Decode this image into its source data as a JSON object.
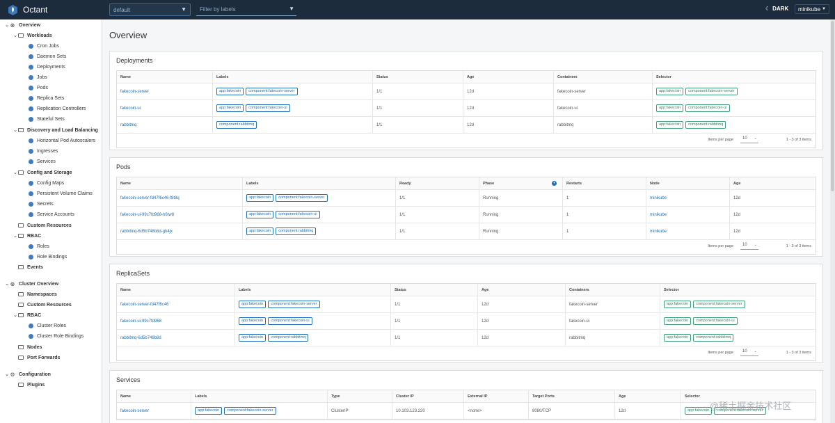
{
  "topbar": {
    "app_name": "Octant",
    "namespace": "default",
    "label_filter_placeholder": "Filter by labels",
    "theme_toggle": "DARK",
    "context": "minikube"
  },
  "sidebar": {
    "overview": "Overview",
    "workloads": "Workloads",
    "cron_jobs": "Cron Jobs",
    "daemon_sets": "Daemon Sets",
    "deployments": "Deployments",
    "jobs": "Jobs",
    "pods": "Pods",
    "replica_sets": "Replica Sets",
    "replication_controllers": "Replication Controllers",
    "stateful_sets": "Stateful Sets",
    "discovery": "Discovery and Load Balancing",
    "hpa": "Horizontal Pod Autoscalers",
    "ingresses": "Ingresses",
    "services": "Services",
    "config_storage": "Config and Storage",
    "config_maps": "Config Maps",
    "pvc": "Persistent Volume Claims",
    "secrets": "Secrets",
    "service_accounts": "Service Accounts",
    "custom_resources": "Custom Resources",
    "rbac": "RBAC",
    "roles": "Roles",
    "role_bindings": "Role Bindings",
    "events": "Events",
    "cluster_overview": "Cluster Overview",
    "namespaces": "Namespaces",
    "cluster_custom_resources": "Custom Resources",
    "cluster_rbac": "RBAC",
    "cluster_roles": "Cluster Roles",
    "cluster_role_bindings": "Cluster Role Bindings",
    "nodes": "Nodes",
    "port_forwards": "Port Forwards",
    "configuration": "Configuration",
    "plugins": "Plugins"
  },
  "page_title": "Overview",
  "pager": {
    "items_per_page": "Items per page",
    "per_page": "10",
    "range": "1 - 3 of 3 items"
  },
  "deployments": {
    "title": "Deployments",
    "headers": [
      "Name",
      "Labels",
      "Status",
      "Age",
      "Containers",
      "Selector"
    ],
    "rows": [
      {
        "name": "fakecoin-server",
        "labels": [
          "app:fakecoin",
          "component:fakecoin-server"
        ],
        "status": "1/1",
        "age": "12d",
        "containers": "fakecoin-server",
        "selector": [
          "app:fakecoin",
          "component:fakecoin-server"
        ]
      },
      {
        "name": "fakecoin-ui",
        "labels": [
          "app:fakecoin",
          "component:fakecoin-ui"
        ],
        "status": "1/1",
        "age": "12d",
        "containers": "fakecoin-ui",
        "selector": [
          "app:fakecoin",
          "component:fakecoin-ui"
        ]
      },
      {
        "name": "rabbitmq",
        "labels": [
          "component:rabbitmq"
        ],
        "status": "1/1",
        "age": "12d",
        "containers": "rabbitmq",
        "selector": [
          "app:fakecoin",
          "component:rabbitmq"
        ]
      }
    ]
  },
  "pods": {
    "title": "Pods",
    "headers": [
      "Name",
      "Labels",
      "Ready",
      "Phase",
      "Restarts",
      "Node",
      "Age"
    ],
    "rows": [
      {
        "name": "fakecoin-server-fd47f6c46-f8t8q",
        "labels": [
          "app:fakecoin",
          "component:fakecoin-server"
        ],
        "ready": "1/1",
        "phase": "Running",
        "restarts": "1",
        "node": "minikube",
        "age": "12d"
      },
      {
        "name": "fakecoin-ui-99c7fd968-h6tw8",
        "labels": [
          "app:fakecoin",
          "component:fakecoin-ui"
        ],
        "ready": "1/1",
        "phase": "Running",
        "restarts": "1",
        "node": "minikube",
        "age": "12d"
      },
      {
        "name": "rabbitmq-6d5b748b8d-gh4jx",
        "labels": [
          "app:fakecoin",
          "component:rabbitmq"
        ],
        "ready": "1/1",
        "phase": "Running",
        "restarts": "1",
        "node": "minikube",
        "age": "12d"
      }
    ]
  },
  "replicasets": {
    "title": "ReplicaSets",
    "headers": [
      "Name",
      "Labels",
      "Status",
      "Age",
      "Containers",
      "Selector"
    ],
    "rows": [
      {
        "name": "fakecoin-server-fd47f6c46",
        "labels": [
          "app:fakecoin",
          "component:fakecoin-server"
        ],
        "status": "1/1",
        "age": "12d",
        "containers": "fakecoin-server",
        "selector": [
          "app:fakecoin",
          "component:fakecoin-server"
        ]
      },
      {
        "name": "fakecoin-ui-99c7fd968",
        "labels": [
          "app:fakecoin",
          "component:fakecoin-ui"
        ],
        "status": "1/1",
        "age": "12d",
        "containers": "fakecoin-ui",
        "selector": [
          "app:fakecoin",
          "component:fakecoin-ui"
        ]
      },
      {
        "name": "rabbitmq-6d5b748b8d",
        "labels": [
          "app:fakecoin",
          "component:rabbitmq"
        ],
        "status": "1/1",
        "age": "12d",
        "containers": "rabbitmq",
        "selector": [
          "app:fakecoin",
          "component:rabbitmq"
        ]
      }
    ]
  },
  "services": {
    "title": "Services",
    "headers": [
      "Name",
      "Labels",
      "Type",
      "Cluster IP",
      "External IP",
      "Target Ports",
      "Age",
      "Selector"
    ],
    "rows": [
      {
        "name": "fakecoin-server",
        "labels": [
          "app:fakecoin",
          "component:fakecoin-server"
        ],
        "type": "ClusterIP",
        "cluster_ip": "10.103.123.220",
        "external_ip": "<none>",
        "target_ports": "8080/TCP",
        "age": "12d",
        "selector": [
          "app:fakecoin",
          "component:fakecoin-server"
        ]
      }
    ]
  },
  "watermark": "@稀土掘金技术社区"
}
